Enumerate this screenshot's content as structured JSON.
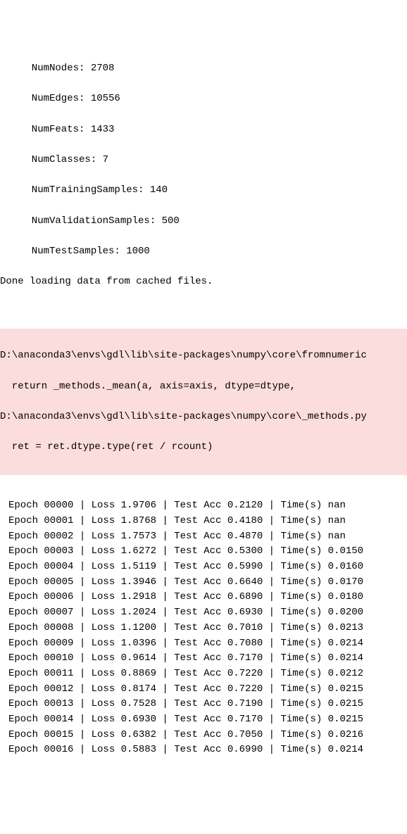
{
  "header": {
    "numnodes_label": "  NumNodes: 2708",
    "numedges_label": "  NumEdges: 10556",
    "numfeats_label": "  NumFeats: 1433",
    "numclasses_label": "  NumClasses: 7",
    "numtrain_label": "  NumTrainingSamples: 140",
    "numvalid_label": "  NumValidationSamples: 500",
    "numtest_label": "  NumTestSamples: 1000",
    "done_label": "Done loading data from cached files."
  },
  "warning": {
    "line1": "D:\\anaconda3\\envs\\gdl\\lib\\site-packages\\numpy\\core\\fromnumeric",
    "line2": "  return _methods._mean(a, axis=axis, dtype=dtype,",
    "line3": "D:\\anaconda3\\envs\\gdl\\lib\\site-packages\\numpy\\core\\_methods.py",
    "line4": "  ret = ret.dtype.type(ret / rcount)"
  },
  "epochs": [
    {
      "epoch": "00000",
      "loss": "1.9706",
      "acc": "0.2120",
      "time": "nan"
    },
    {
      "epoch": "00001",
      "loss": "1.8768",
      "acc": "0.4180",
      "time": "nan"
    },
    {
      "epoch": "00002",
      "loss": "1.7573",
      "acc": "0.4870",
      "time": "nan"
    },
    {
      "epoch": "00003",
      "loss": "1.6272",
      "acc": "0.5300",
      "time": "0.0150"
    },
    {
      "epoch": "00004",
      "loss": "1.5119",
      "acc": "0.5990",
      "time": "0.0160"
    },
    {
      "epoch": "00005",
      "loss": "1.3946",
      "acc": "0.6640",
      "time": "0.0170"
    },
    {
      "epoch": "00006",
      "loss": "1.2918",
      "acc": "0.6890",
      "time": "0.0180"
    },
    {
      "epoch": "00007",
      "loss": "1.2024",
      "acc": "0.6930",
      "time": "0.0200"
    },
    {
      "epoch": "00008",
      "loss": "1.1200",
      "acc": "0.7010",
      "time": "0.0213"
    },
    {
      "epoch": "00009",
      "loss": "1.0396",
      "acc": "0.7080",
      "time": "0.0214"
    },
    {
      "epoch": "00010",
      "loss": "0.9614",
      "acc": "0.7170",
      "time": "0.0214"
    },
    {
      "epoch": "00011",
      "loss": "0.8869",
      "acc": "0.7220",
      "time": "0.0212"
    },
    {
      "epoch": "00012",
      "loss": "0.8174",
      "acc": "0.7220",
      "time": "0.0215"
    },
    {
      "epoch": "00013",
      "loss": "0.7528",
      "acc": "0.7190",
      "time": "0.0215"
    },
    {
      "epoch": "00014",
      "loss": "0.6930",
      "acc": "0.7170",
      "time": "0.0215"
    },
    {
      "epoch": "00015",
      "loss": "0.6382",
      "acc": "0.7050",
      "time": "0.0216"
    },
    {
      "epoch": "00016",
      "loss": "0.5883",
      "acc": "0.6990",
      "time": "0.0214"
    }
  ],
  "labels": {
    "epoch": "Epoch",
    "loss": "Loss",
    "acc": "Test Acc",
    "time": "Time(s)"
  }
}
